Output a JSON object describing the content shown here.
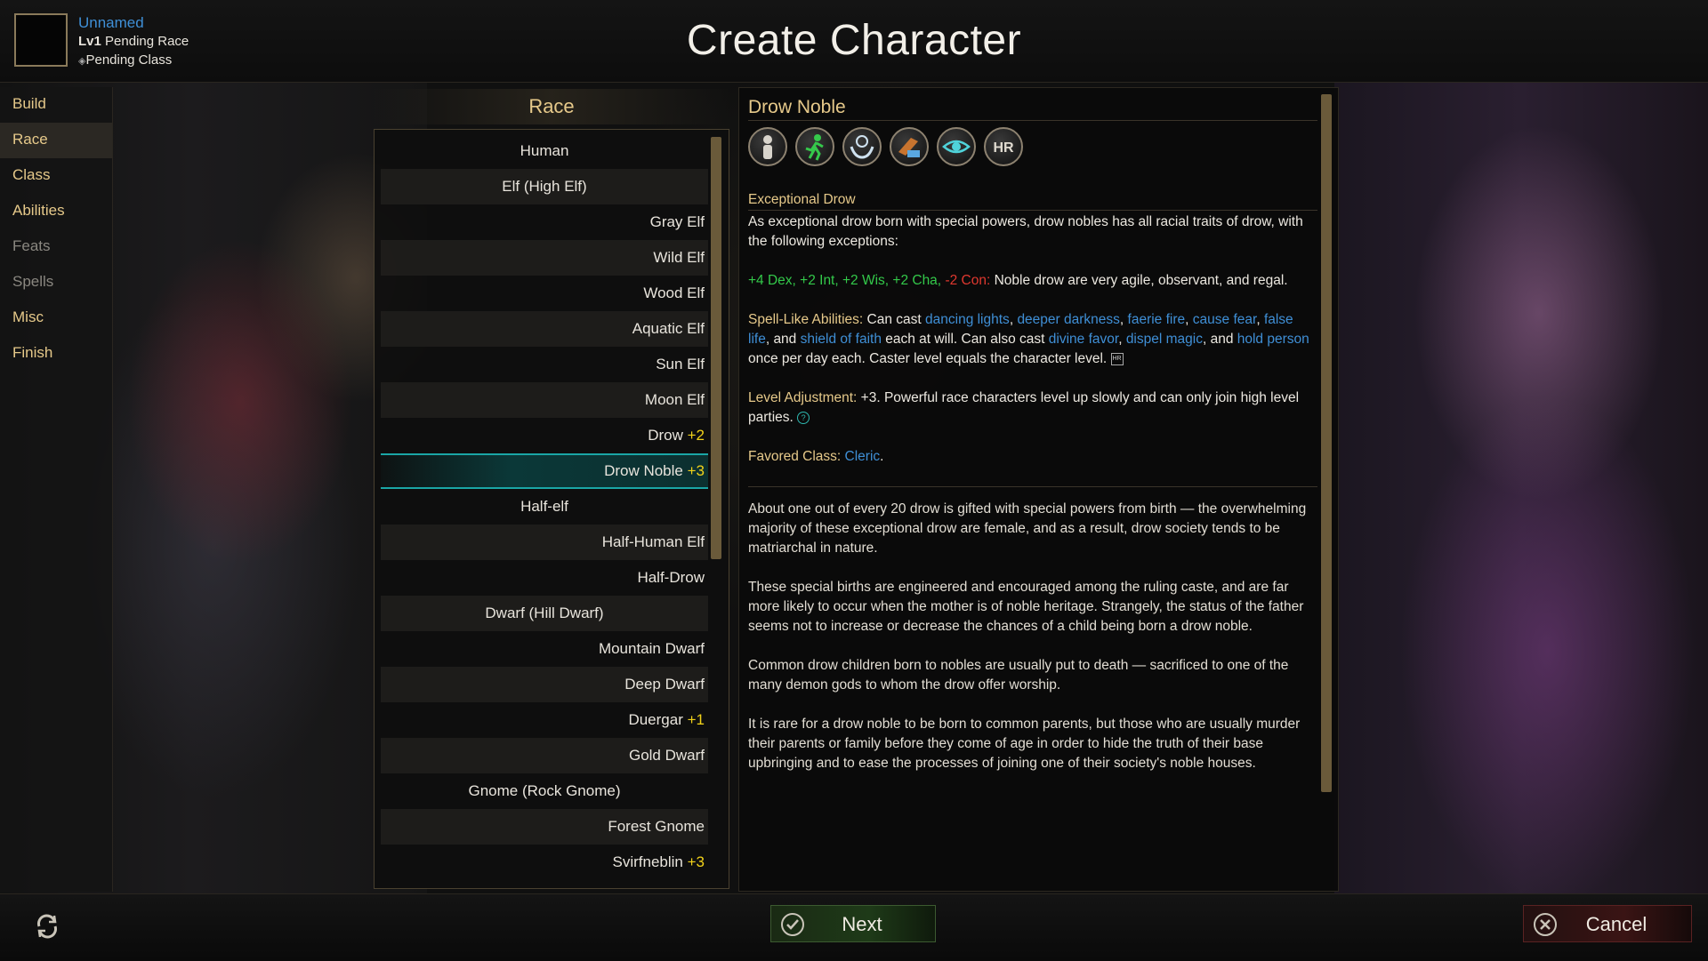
{
  "header": {
    "title": "Create Character",
    "character": {
      "name": "Unnamed",
      "level_label": "Lv1",
      "race_status": "Pending Race",
      "class_status": "Pending Class"
    }
  },
  "nav": {
    "items": [
      {
        "label": "Build",
        "state": "enabled"
      },
      {
        "label": "Race",
        "state": "active"
      },
      {
        "label": "Class",
        "state": "enabled"
      },
      {
        "label": "Abilities",
        "state": "enabled"
      },
      {
        "label": "Feats",
        "state": "disabled"
      },
      {
        "label": "Spells",
        "state": "disabled"
      },
      {
        "label": "Misc",
        "state": "enabled"
      },
      {
        "label": "Finish",
        "state": "enabled"
      }
    ]
  },
  "race_panel": {
    "title": "Race",
    "items": [
      {
        "name": "Human",
        "mod": "",
        "group_header": true
      },
      {
        "name": "Elf (High Elf)",
        "mod": "",
        "group_header": true
      },
      {
        "name": "Gray Elf",
        "mod": ""
      },
      {
        "name": "Wild Elf",
        "mod": ""
      },
      {
        "name": "Wood Elf",
        "mod": ""
      },
      {
        "name": "Aquatic Elf",
        "mod": ""
      },
      {
        "name": "Sun Elf",
        "mod": ""
      },
      {
        "name": "Moon Elf",
        "mod": ""
      },
      {
        "name": "Drow",
        "mod": "+2"
      },
      {
        "name": "Drow Noble",
        "mod": "+3",
        "selected": true
      },
      {
        "name": "Half-elf",
        "mod": "",
        "group_header": true
      },
      {
        "name": "Half-Human Elf",
        "mod": ""
      },
      {
        "name": "Half-Drow",
        "mod": ""
      },
      {
        "name": "Dwarf (Hill Dwarf)",
        "mod": "",
        "group_header": true
      },
      {
        "name": "Mountain Dwarf",
        "mod": ""
      },
      {
        "name": "Deep Dwarf",
        "mod": ""
      },
      {
        "name": "Duergar",
        "mod": "+1"
      },
      {
        "name": "Gold Dwarf",
        "mod": ""
      },
      {
        "name": "Gnome (Rock Gnome)",
        "mod": "",
        "group_header": true
      },
      {
        "name": "Forest Gnome",
        "mod": ""
      },
      {
        "name": "Svirfneblin",
        "mod": "+3"
      }
    ]
  },
  "detail": {
    "title": "Drow Noble",
    "trait_icons": [
      "humanoid-icon",
      "running-figure-icon",
      "summon-hands-icon",
      "hand-with-scroll-icon",
      "eye-icon",
      "hr-badge-icon"
    ],
    "trait_heading": "Exceptional Drow",
    "trait_text": "As exceptional drow born with special powers, drow nobles has all racial traits of drow, with the following exceptions:",
    "ability_bonus": "+4 Dex, +2 Int, +2 Wis, +2 Cha,",
    "ability_penalty": "-2 Con:",
    "ability_text": " Noble drow are very agile, observant, and regal.",
    "sla": {
      "label": "Spell-Like Abilities:",
      "intro": " Can cast ",
      "at_will": [
        "dancing lights",
        "deeper darkness",
        "faerie fire",
        "cause fear",
        "false life"
      ],
      "at_will_last": "shield of faith",
      "mid": " each at will. Can also cast ",
      "daily": [
        "divine favor",
        "dispel magic"
      ],
      "daily_last": "hold person",
      "end": " once per day each. Caster level equals the character level."
    },
    "level_adjustment": {
      "label": "Level Adjustment:",
      "text": " +3. Powerful race characters level up slowly and can only join high level parties."
    },
    "favored_class": {
      "label": "Favored Class:",
      "value": "Cleric"
    },
    "lore": [
      "About one out of every 20 drow is gifted with special powers from birth — the overwhelming majority of these exceptional drow are female, and as a result, drow society tends to be matriarchal in nature.",
      "These special births are engineered and encouraged among the ruling caste, and are far more likely to occur when the mother is of noble heritage. Strangely, the status of the father seems not to increase or decrease the chances of a child being born a drow noble.",
      "Common drow children born to nobles are usually put to death — sacrificed to one of the many demon gods to whom the drow offer worship.",
      "It is rare for a drow noble to be born to common parents, but those who are usually murder their parents or family before they come of age in order to hide the truth of their base upbringing and to ease the processes of joining one of their society's noble houses."
    ]
  },
  "footer": {
    "next_label": "Next",
    "cancel_label": "Cancel"
  }
}
